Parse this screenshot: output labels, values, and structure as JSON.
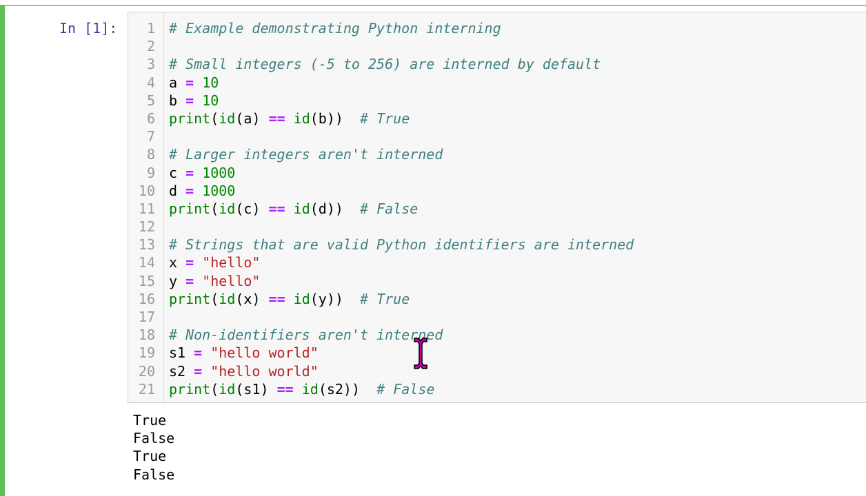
{
  "cell": {
    "prompt": "In [1]:"
  },
  "code_lines": [
    {
      "num": "1",
      "tokens": [
        {
          "t": "# Example demonstrating Python interning",
          "c": "comment"
        }
      ]
    },
    {
      "num": "2",
      "tokens": []
    },
    {
      "num": "3",
      "tokens": [
        {
          "t": "# Small integers (-5 to 256) are interned by default",
          "c": "comment"
        }
      ]
    },
    {
      "num": "4",
      "tokens": [
        {
          "t": "a ",
          "c": "plain"
        },
        {
          "t": "=",
          "c": "op"
        },
        {
          "t": " ",
          "c": "plain"
        },
        {
          "t": "10",
          "c": "num"
        }
      ]
    },
    {
      "num": "5",
      "tokens": [
        {
          "t": "b ",
          "c": "plain"
        },
        {
          "t": "=",
          "c": "op"
        },
        {
          "t": " ",
          "c": "plain"
        },
        {
          "t": "10",
          "c": "num"
        }
      ]
    },
    {
      "num": "6",
      "tokens": [
        {
          "t": "print",
          "c": "builtin"
        },
        {
          "t": "(",
          "c": "plain"
        },
        {
          "t": "id",
          "c": "builtin"
        },
        {
          "t": "(a) ",
          "c": "plain"
        },
        {
          "t": "==",
          "c": "op"
        },
        {
          "t": " ",
          "c": "plain"
        },
        {
          "t": "id",
          "c": "builtin"
        },
        {
          "t": "(b))  ",
          "c": "plain"
        },
        {
          "t": "# True",
          "c": "comment"
        }
      ]
    },
    {
      "num": "7",
      "tokens": []
    },
    {
      "num": "8",
      "tokens": [
        {
          "t": "# Larger integers aren't interned",
          "c": "comment"
        }
      ]
    },
    {
      "num": "9",
      "tokens": [
        {
          "t": "c ",
          "c": "plain"
        },
        {
          "t": "=",
          "c": "op"
        },
        {
          "t": " ",
          "c": "plain"
        },
        {
          "t": "1000",
          "c": "num"
        }
      ]
    },
    {
      "num": "10",
      "tokens": [
        {
          "t": "d ",
          "c": "plain"
        },
        {
          "t": "=",
          "c": "op"
        },
        {
          "t": " ",
          "c": "plain"
        },
        {
          "t": "1000",
          "c": "num"
        }
      ]
    },
    {
      "num": "11",
      "tokens": [
        {
          "t": "print",
          "c": "builtin"
        },
        {
          "t": "(",
          "c": "plain"
        },
        {
          "t": "id",
          "c": "builtin"
        },
        {
          "t": "(c) ",
          "c": "plain"
        },
        {
          "t": "==",
          "c": "op"
        },
        {
          "t": " ",
          "c": "plain"
        },
        {
          "t": "id",
          "c": "builtin"
        },
        {
          "t": "(d))  ",
          "c": "plain"
        },
        {
          "t": "# False",
          "c": "comment"
        }
      ]
    },
    {
      "num": "12",
      "tokens": []
    },
    {
      "num": "13",
      "tokens": [
        {
          "t": "# Strings that are valid Python identifiers are interned",
          "c": "comment"
        }
      ]
    },
    {
      "num": "14",
      "tokens": [
        {
          "t": "x ",
          "c": "plain"
        },
        {
          "t": "=",
          "c": "op"
        },
        {
          "t": " ",
          "c": "plain"
        },
        {
          "t": "\"hello\"",
          "c": "str"
        }
      ]
    },
    {
      "num": "15",
      "tokens": [
        {
          "t": "y ",
          "c": "plain"
        },
        {
          "t": "=",
          "c": "op"
        },
        {
          "t": " ",
          "c": "plain"
        },
        {
          "t": "\"hello\"",
          "c": "str"
        }
      ]
    },
    {
      "num": "16",
      "tokens": [
        {
          "t": "print",
          "c": "builtin"
        },
        {
          "t": "(",
          "c": "plain"
        },
        {
          "t": "id",
          "c": "builtin"
        },
        {
          "t": "(x) ",
          "c": "plain"
        },
        {
          "t": "==",
          "c": "op"
        },
        {
          "t": " ",
          "c": "plain"
        },
        {
          "t": "id",
          "c": "builtin"
        },
        {
          "t": "(y))  ",
          "c": "plain"
        },
        {
          "t": "# True",
          "c": "comment"
        }
      ]
    },
    {
      "num": "17",
      "tokens": []
    },
    {
      "num": "18",
      "tokens": [
        {
          "t": "# Non-identifiers aren't interned",
          "c": "comment"
        }
      ]
    },
    {
      "num": "19",
      "tokens": [
        {
          "t": "s1 ",
          "c": "plain"
        },
        {
          "t": "=",
          "c": "op"
        },
        {
          "t": " ",
          "c": "plain"
        },
        {
          "t": "\"hello world\"",
          "c": "str"
        }
      ]
    },
    {
      "num": "20",
      "tokens": [
        {
          "t": "s2 ",
          "c": "plain"
        },
        {
          "t": "=",
          "c": "op"
        },
        {
          "t": " ",
          "c": "plain"
        },
        {
          "t": "\"hello world\"",
          "c": "str"
        }
      ]
    },
    {
      "num": "21",
      "tokens": [
        {
          "t": "print",
          "c": "builtin"
        },
        {
          "t": "(",
          "c": "plain"
        },
        {
          "t": "id",
          "c": "builtin"
        },
        {
          "t": "(s1) ",
          "c": "plain"
        },
        {
          "t": "==",
          "c": "op"
        },
        {
          "t": " ",
          "c": "plain"
        },
        {
          "t": "id",
          "c": "builtin"
        },
        {
          "t": "(s2))  ",
          "c": "plain"
        },
        {
          "t": "# False",
          "c": "comment"
        }
      ]
    }
  ],
  "output_lines": [
    "True",
    "False",
    "True",
    "False"
  ],
  "colors": {
    "cell_border_active": "#5fbf5a",
    "prompt": "#303f9f",
    "editor_bg": "#f7f7f7",
    "comment": "#408080",
    "operator": "#aa22ff",
    "number": "#008800",
    "builtin": "#008000",
    "string": "#ba2121",
    "cursor": "#cc00aa"
  },
  "icons": {
    "mouse_cursor": "text-ibeam-cursor-icon"
  }
}
